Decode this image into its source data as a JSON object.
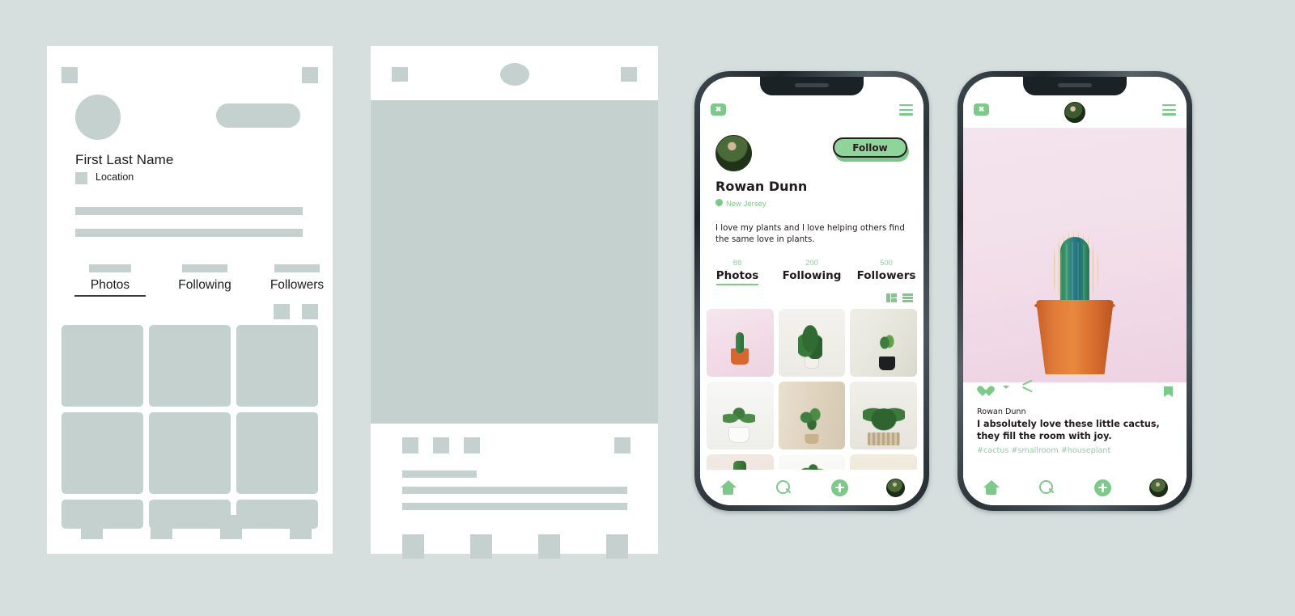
{
  "canvas": {
    "background": "#d7dfde",
    "placeholder": "#c5d1cf",
    "accent": "#7dc98a",
    "ink": "#231a1e"
  },
  "wireframe_profile": {
    "name": "First Last Name",
    "location": "Location",
    "icons": {
      "top_left": "square-icon",
      "top_right": "square-icon",
      "avatar": "avatar-placeholder",
      "action": "button-placeholder",
      "location": "location-marker-placeholder"
    },
    "tabs": [
      {
        "label": "Photos",
        "active": true
      },
      {
        "label": "Following",
        "active": false
      },
      {
        "label": "Followers",
        "active": false
      }
    ],
    "view_toggles": [
      "grid-view-placeholder",
      "list-view-placeholder"
    ],
    "grid_cells": 9,
    "nav_items": 4
  },
  "wireframe_post": {
    "header_icons": [
      "square-icon",
      "avatar-placeholder",
      "square-icon"
    ],
    "hero": "image-placeholder",
    "action_icons": [
      "like-placeholder",
      "comment-placeholder",
      "share-placeholder",
      "bookmark-placeholder"
    ],
    "text_lines": 3,
    "nav_items": 4
  },
  "phone_profile": {
    "statusbar": {
      "close_icon": "close-icon",
      "close_glyph": "✖",
      "menu_icon": "hamburger-menu-icon"
    },
    "avatar": "profile-avatar",
    "follow_button": "Follow",
    "name": "Rowan Dunn",
    "location": "New Jersey",
    "location_icon": "map-pin-icon",
    "bio": "I love my plants and I love helping others find the same love in plants.",
    "stats": [
      {
        "count": "88",
        "label": "Photos",
        "active": true
      },
      {
        "count": "200",
        "label": "Following",
        "active": false
      },
      {
        "count": "500",
        "label": "Followers",
        "active": false
      }
    ],
    "view_toggles": [
      "grid-view-icon",
      "list-view-icon"
    ],
    "photos": [
      "cactus-in-orange-pot-pink-background",
      "fiddle-leaf-fig-in-white-pot",
      "snake-plant-in-black-pot",
      "aloe-in-white-pot",
      "green-plant-in-woven-basket",
      "succulent-in-woven-basket",
      "cactus-on-beige-background",
      "snake-plant-cluster",
      "beige-plant-photo"
    ],
    "bottom_nav": [
      {
        "icon": "home-icon",
        "active": true
      },
      {
        "icon": "search-icon",
        "active": false
      },
      {
        "icon": "add-post-icon",
        "active": false
      },
      {
        "icon": "profile-avatar-icon",
        "active": false
      }
    ]
  },
  "phone_post": {
    "statusbar": {
      "close_icon": "close-icon",
      "close_glyph": "✖",
      "avatar": "header-avatar",
      "menu_icon": "hamburger-menu-icon"
    },
    "photo": "cactus-in-terracotta-pot-on-pink-background",
    "actions": [
      {
        "icon": "heart-icon"
      },
      {
        "icon": "comment-icon"
      },
      {
        "icon": "share-icon"
      },
      {
        "icon": "bookmark-icon"
      }
    ],
    "username": "Rowan Dunn",
    "caption": "I absolutely love these little cactus, they fill the room with joy.",
    "hashtags": "#cactus #smallroom #houseplant",
    "bottom_nav": [
      {
        "icon": "home-icon",
        "active": true
      },
      {
        "icon": "search-icon",
        "active": false
      },
      {
        "icon": "add-post-icon",
        "active": false
      },
      {
        "icon": "profile-avatar-icon",
        "active": false
      }
    ]
  }
}
